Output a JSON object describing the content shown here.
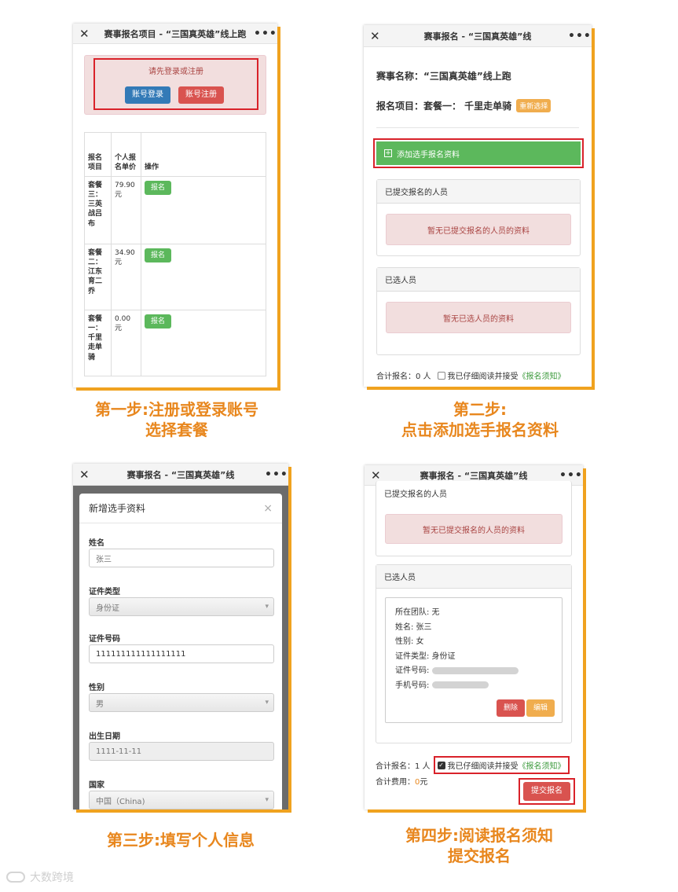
{
  "panel1": {
    "title": "赛事报名项目 - “三国真英雄”线上跑",
    "login_prompt": "请先登录或注册",
    "login_btn": "账号登录",
    "register_btn": "账号注册",
    "table": {
      "headers": [
        "报名项目",
        "个人报名单价",
        "操作"
      ],
      "rows": [
        {
          "item": "套餐三：三英战吕布",
          "price": "79.90元",
          "action": "报名"
        },
        {
          "item": "套餐二：江东育二乔",
          "price": "34.90元",
          "action": "报名"
        },
        {
          "item": "套餐一：千里走单骑",
          "price": "0.00元",
          "action": "报名"
        }
      ]
    },
    "caption": [
      "第一步:注册或登录账号",
      "选择套餐"
    ]
  },
  "panel2": {
    "title": "赛事报名 - “三国真英雄”线",
    "event_name": "赛事名称：“三国真英雄”线上跑",
    "item_label": "报名项目：套餐一： 千里走单骑",
    "reselect": "重新选择",
    "add_btn": "添加选手报名资料",
    "submitted_header": "已提交报名的人员",
    "submitted_empty": "暂无已提交报名的人员的资料",
    "selected_header": "已选人员",
    "selected_empty": "暂无已选人员的资料",
    "total": "合计报名：0 人",
    "agree_text": "我已仔细阅读并接受",
    "agree_link": "《报名须知》",
    "caption": [
      "第二步:",
      "点击添加选手报名资料"
    ]
  },
  "panel3": {
    "title": "赛事报名 - “三国真英雄”线",
    "modal_title": "新增选手资料",
    "close": "×",
    "fields": [
      {
        "label": "姓名",
        "value": "张三",
        "type": "input"
      },
      {
        "label": "证件类型",
        "value": "身份证",
        "type": "select"
      },
      {
        "label": "证件号码",
        "value": "111111111111111111",
        "type": "input"
      },
      {
        "label": "性别",
        "value": "男",
        "type": "select"
      },
      {
        "label": "出生日期",
        "value": "1111-11-11",
        "type": "input"
      },
      {
        "label": "国家",
        "value": "中国（China)",
        "type": "select"
      }
    ],
    "caption": "第三步:填写个人信息"
  },
  "panel4": {
    "title": "赛事报名 - “三国真英雄”线",
    "submitted_header": "已提交报名的人员",
    "submitted_empty": "暂无已提交报名的人员的资料",
    "selected_header": "已选人员",
    "person": {
      "team": "所在团队: 无",
      "name": "姓名: 张三",
      "gender": "性别: 女",
      "id_type": "证件类型: 身份证",
      "id_no": "证件号码:",
      "phone": "手机号码:"
    },
    "delete_btn": "删除",
    "edit_btn": "编辑",
    "total": "合计报名：1 人",
    "agree_text": "我已仔细阅读并接受",
    "agree_link": "《报名须知》",
    "fee_label": "合计费用：",
    "fee_value": "0",
    "fee_unit": "元",
    "submit_btn": "提交报名",
    "caption": [
      "第四步:阅读报名须知",
      "提交报名"
    ]
  },
  "watermark": "大数跨境"
}
